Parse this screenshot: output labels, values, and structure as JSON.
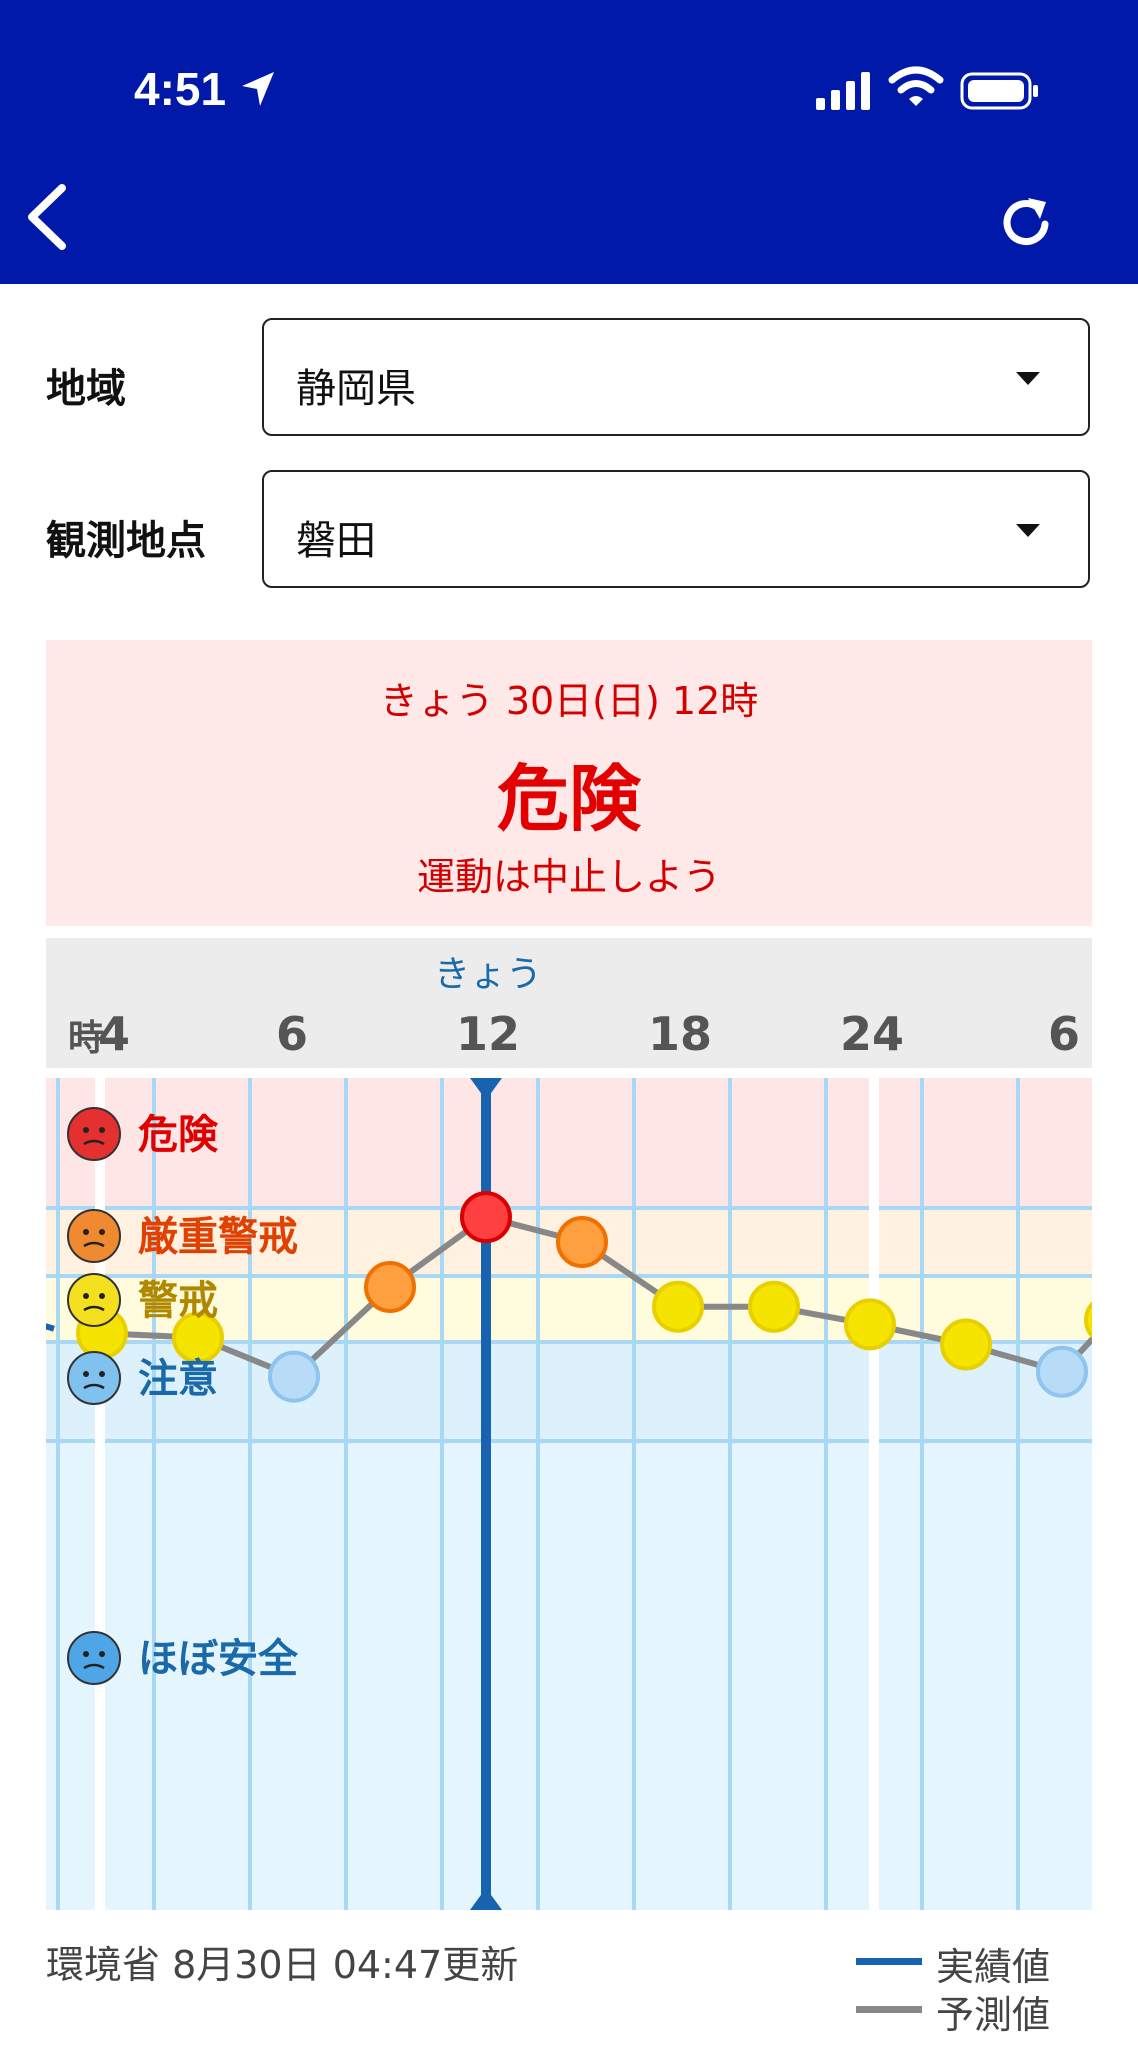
{
  "status_bar": {
    "time": "4:51"
  },
  "header": {
    "back_icon": "chevron-left-icon",
    "refresh_icon": "refresh-icon"
  },
  "region": {
    "label": "地域",
    "value": "静岡県"
  },
  "station": {
    "label": "観測地点",
    "value": "磐田"
  },
  "alert": {
    "date": "きょう 30日(日) 12時",
    "level": "危険",
    "advice": "運動は中止しよう"
  },
  "chart_data": {
    "type": "line",
    "day_label": "きょう",
    "hour_unit": "時",
    "x_ticks": [
      {
        "x": 0,
        "label": "4"
      },
      {
        "x": 2,
        "label": "6"
      },
      {
        "x": 8,
        "label": "12"
      },
      {
        "x": 14,
        "label": "18"
      },
      {
        "x": 20,
        "label": "24"
      },
      {
        "x": 26,
        "label": "6"
      }
    ],
    "current_x": 8,
    "xlim": [
      -1.3,
      25.7
    ],
    "levels": [
      {
        "name": "危険",
        "color": "#e00000",
        "bg": "#ffe6e6",
        "face": "#e53030",
        "from": 31,
        "to": 36
      },
      {
        "name": "厳重警戒",
        "color": "#e04000",
        "bg": "#fff0e0",
        "face": "#f08a30",
        "from": 28,
        "to": 31
      },
      {
        "name": "警戒",
        "color": "#b08800",
        "bg": "#fffbdc",
        "face": "#f5e020",
        "from": 25,
        "to": 28
      },
      {
        "name": "注意",
        "color": "#1a6aaa",
        "bg": "#dcf1fc",
        "face": "#7fc2f0",
        "from": 21,
        "to": 25
      },
      {
        "name": "ほぼ安全",
        "color": "#1a6aaa",
        "bg": "#e4f5fd",
        "face": "#4fa6e6",
        "from": 0,
        "to": 21
      }
    ],
    "actual": [
      {
        "x": -1.3,
        "y": 25.8
      },
      {
        "x": -1,
        "y": 25.6
      }
    ],
    "forecast": [
      {
        "x": 0,
        "y": 25.4,
        "level": "警戒"
      },
      {
        "x": 2,
        "y": 25.2,
        "level": "警戒"
      },
      {
        "x": 4,
        "y": 23.6,
        "level": "注意"
      },
      {
        "x": 6,
        "y": 27.5,
        "level": "厳重警戒"
      },
      {
        "x": 8,
        "y": 30.6,
        "level": "危険"
      },
      {
        "x": 10,
        "y": 29.5,
        "level": "厳重警戒"
      },
      {
        "x": 12,
        "y": 26.6,
        "level": "警戒"
      },
      {
        "x": 14,
        "y": 26.6,
        "level": "警戒"
      },
      {
        "x": 16,
        "y": 25.8,
        "level": "警戒"
      },
      {
        "x": 18,
        "y": 24.9,
        "level": "警戒"
      },
      {
        "x": 20,
        "y": 23.8,
        "level": "注意"
      },
      {
        "x": 21,
        "y": 26.0,
        "level": "警戒"
      }
    ],
    "colors": {
      "actual": "#1763b0",
      "forecast": "#888888"
    }
  },
  "footer": {
    "source": "環境省 8月30日 04:47更新"
  },
  "legend": [
    {
      "label": "実績値",
      "color": "#1763b0"
    },
    {
      "label": "予測値",
      "color": "#888888"
    }
  ]
}
